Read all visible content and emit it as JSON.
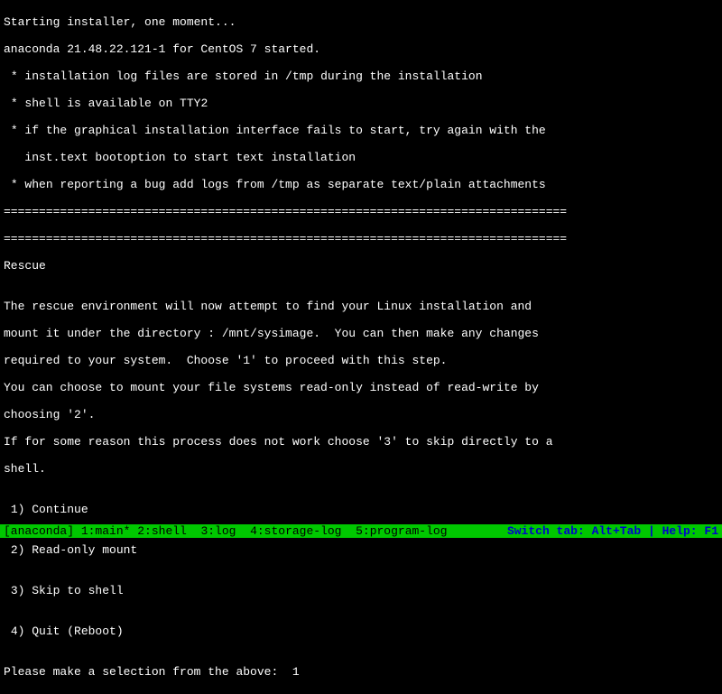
{
  "boot": {
    "line1": "Starting installer, one moment...",
    "line2": "anaconda 21.48.22.121-1 for CentOS 7 started.",
    "bullet1": " * installation log files are stored in /tmp during the installation",
    "bullet2": " * shell is available on TTY2",
    "bullet3": " * if the graphical installation interface fails to start, try again with the",
    "bullet3b": "   inst.text bootoption to start text installation",
    "bullet4": " * when reporting a bug add logs from /tmp as separate text/plain attachments",
    "divider": "================================================================================"
  },
  "rescue": {
    "title": "Rescue",
    "blank": "",
    "para1a": "The rescue environment will now attempt to find your Linux installation and",
    "para1b": "mount it under the directory : /mnt/sysimage.  You can then make any changes",
    "para1c": "required to your system.  Choose '1' to proceed with this step.",
    "para2a": "You can choose to mount your file systems read-only instead of read-write by",
    "para2b": "choosing '2'.",
    "para3a": "If for some reason this process does not work choose '3' to skip directly to a",
    "para3b": "shell."
  },
  "menu": {
    "opt1": " 1) Continue",
    "opt2": " 2) Read-only mount",
    "opt3": " 3) Skip to shell",
    "opt4": " 4) Quit (Reboot)"
  },
  "prompt": {
    "text": "Please make a selection from the above:  ",
    "input": "1"
  },
  "statusbar": {
    "app": "[anaconda]",
    "tab1": " 1:main* ",
    "tab2": "2:shell  ",
    "tab3": "3:log  ",
    "tab4": "4:storage-log  ",
    "tab5": "5:program-log",
    "help": "Switch tab: Alt+Tab | Help: F1 "
  }
}
